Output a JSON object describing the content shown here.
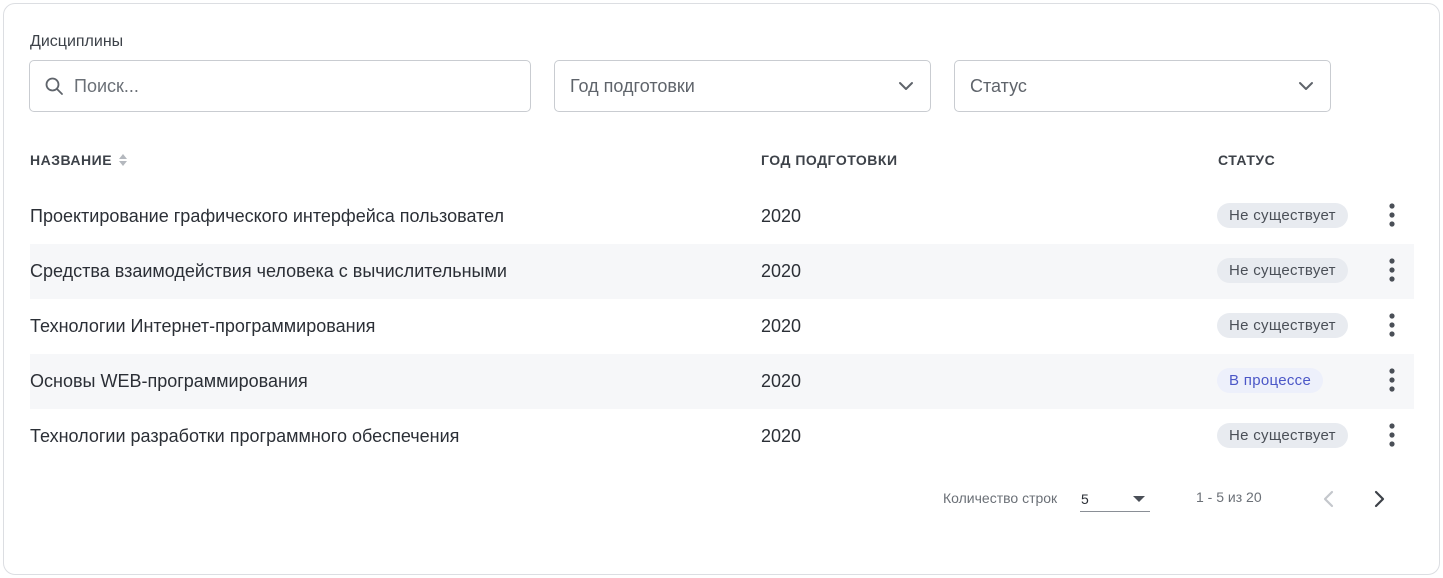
{
  "section": {
    "title": "Дисциплины"
  },
  "filters": {
    "search_placeholder": "Поиск...",
    "search_value": "",
    "year_select": "Год подготовки",
    "status_select": "Статус"
  },
  "table": {
    "columns": {
      "name": "НАЗВАНИЕ",
      "year": "ГОД ПОДГОТОВКИ",
      "status": "СТАТУС"
    },
    "rows": [
      {
        "name": "Проектирование графического интерфейса пользовател",
        "year": "2020",
        "status": "Не существует",
        "status_kind": "none"
      },
      {
        "name": "Средства взаимодействия человека с вычислительными",
        "year": "2020",
        "status": "Не существует",
        "status_kind": "none"
      },
      {
        "name": "Технологии Интернет-программирования",
        "year": "2020",
        "status": "Не существует",
        "status_kind": "none"
      },
      {
        "name": "Основы WEB-программирования",
        "year": "2020",
        "status": "В процессе",
        "status_kind": "progress"
      },
      {
        "name": "Технологии разработки программного обеспечения",
        "year": "2020",
        "status": "Не существует",
        "status_kind": "none"
      }
    ]
  },
  "pagination": {
    "rows_label": "Количество строк",
    "rows_value": "5",
    "range": "1 - 5 из 20"
  },
  "colors": {
    "border": "#dcdee2",
    "row_alt": "#f6f7f9",
    "badge_none_bg": "#e8ebf0",
    "badge_progress_bg": "#edf0fb",
    "badge_progress_text": "#4b57c7"
  }
}
